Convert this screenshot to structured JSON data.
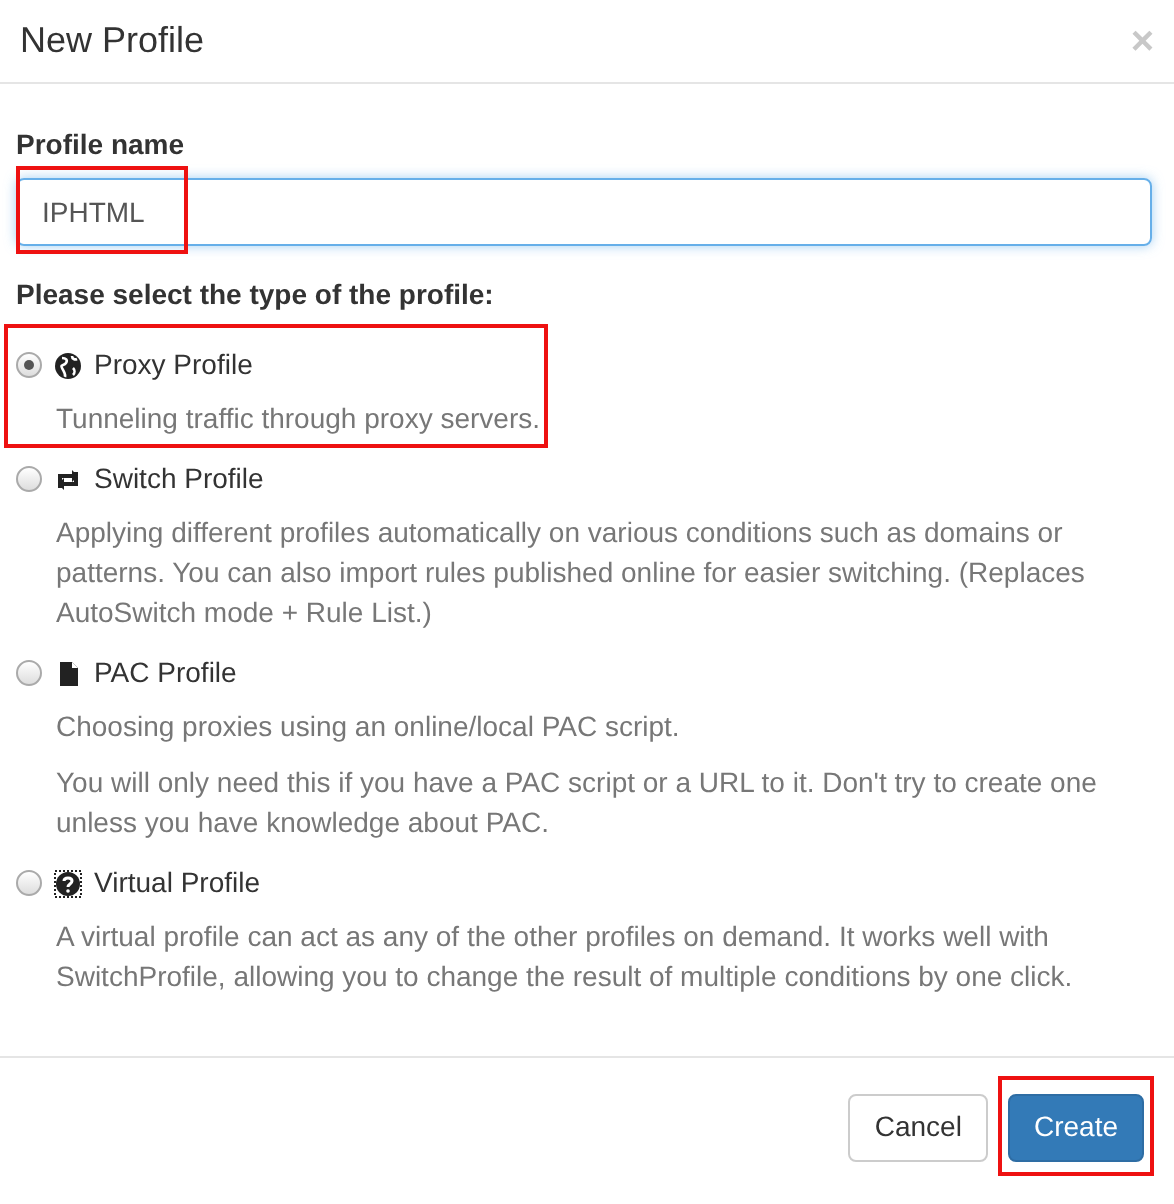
{
  "dialog": {
    "title": "New Profile",
    "close": "×"
  },
  "name_field": {
    "label": "Profile name",
    "value": "IPHTML",
    "highlighted": true
  },
  "type_prompt": "Please select the type of the profile:",
  "options": [
    {
      "kind": "globe",
      "label": "Proxy Profile",
      "selected": true,
      "highlighted": true,
      "description": [
        "Tunneling traffic through proxy servers."
      ]
    },
    {
      "kind": "switch",
      "label": "Switch Profile",
      "selected": false,
      "highlighted": false,
      "description": [
        "Applying different profiles automatically on various conditions such as domains or patterns. You can also import rules published online for easier switching. (Replaces AutoSwitch mode + Rule List.)"
      ]
    },
    {
      "kind": "file",
      "label": "PAC Profile",
      "selected": false,
      "highlighted": false,
      "description": [
        "Choosing proxies using an online/local PAC script.",
        "You will only need this if you have a PAC script or a URL to it. Don't try to create one unless you have knowledge about PAC."
      ]
    },
    {
      "kind": "question",
      "label": "Virtual Profile",
      "selected": false,
      "highlighted": false,
      "description": [
        "A virtual profile can act as any of the other profiles on demand. It works well with SwitchProfile, allowing you to change the result of multiple conditions by one click."
      ]
    }
  ],
  "buttons": [
    {
      "kind": "default",
      "label": "Cancel",
      "highlighted": false
    },
    {
      "kind": "primary",
      "label": "Create",
      "highlighted": true
    }
  ]
}
